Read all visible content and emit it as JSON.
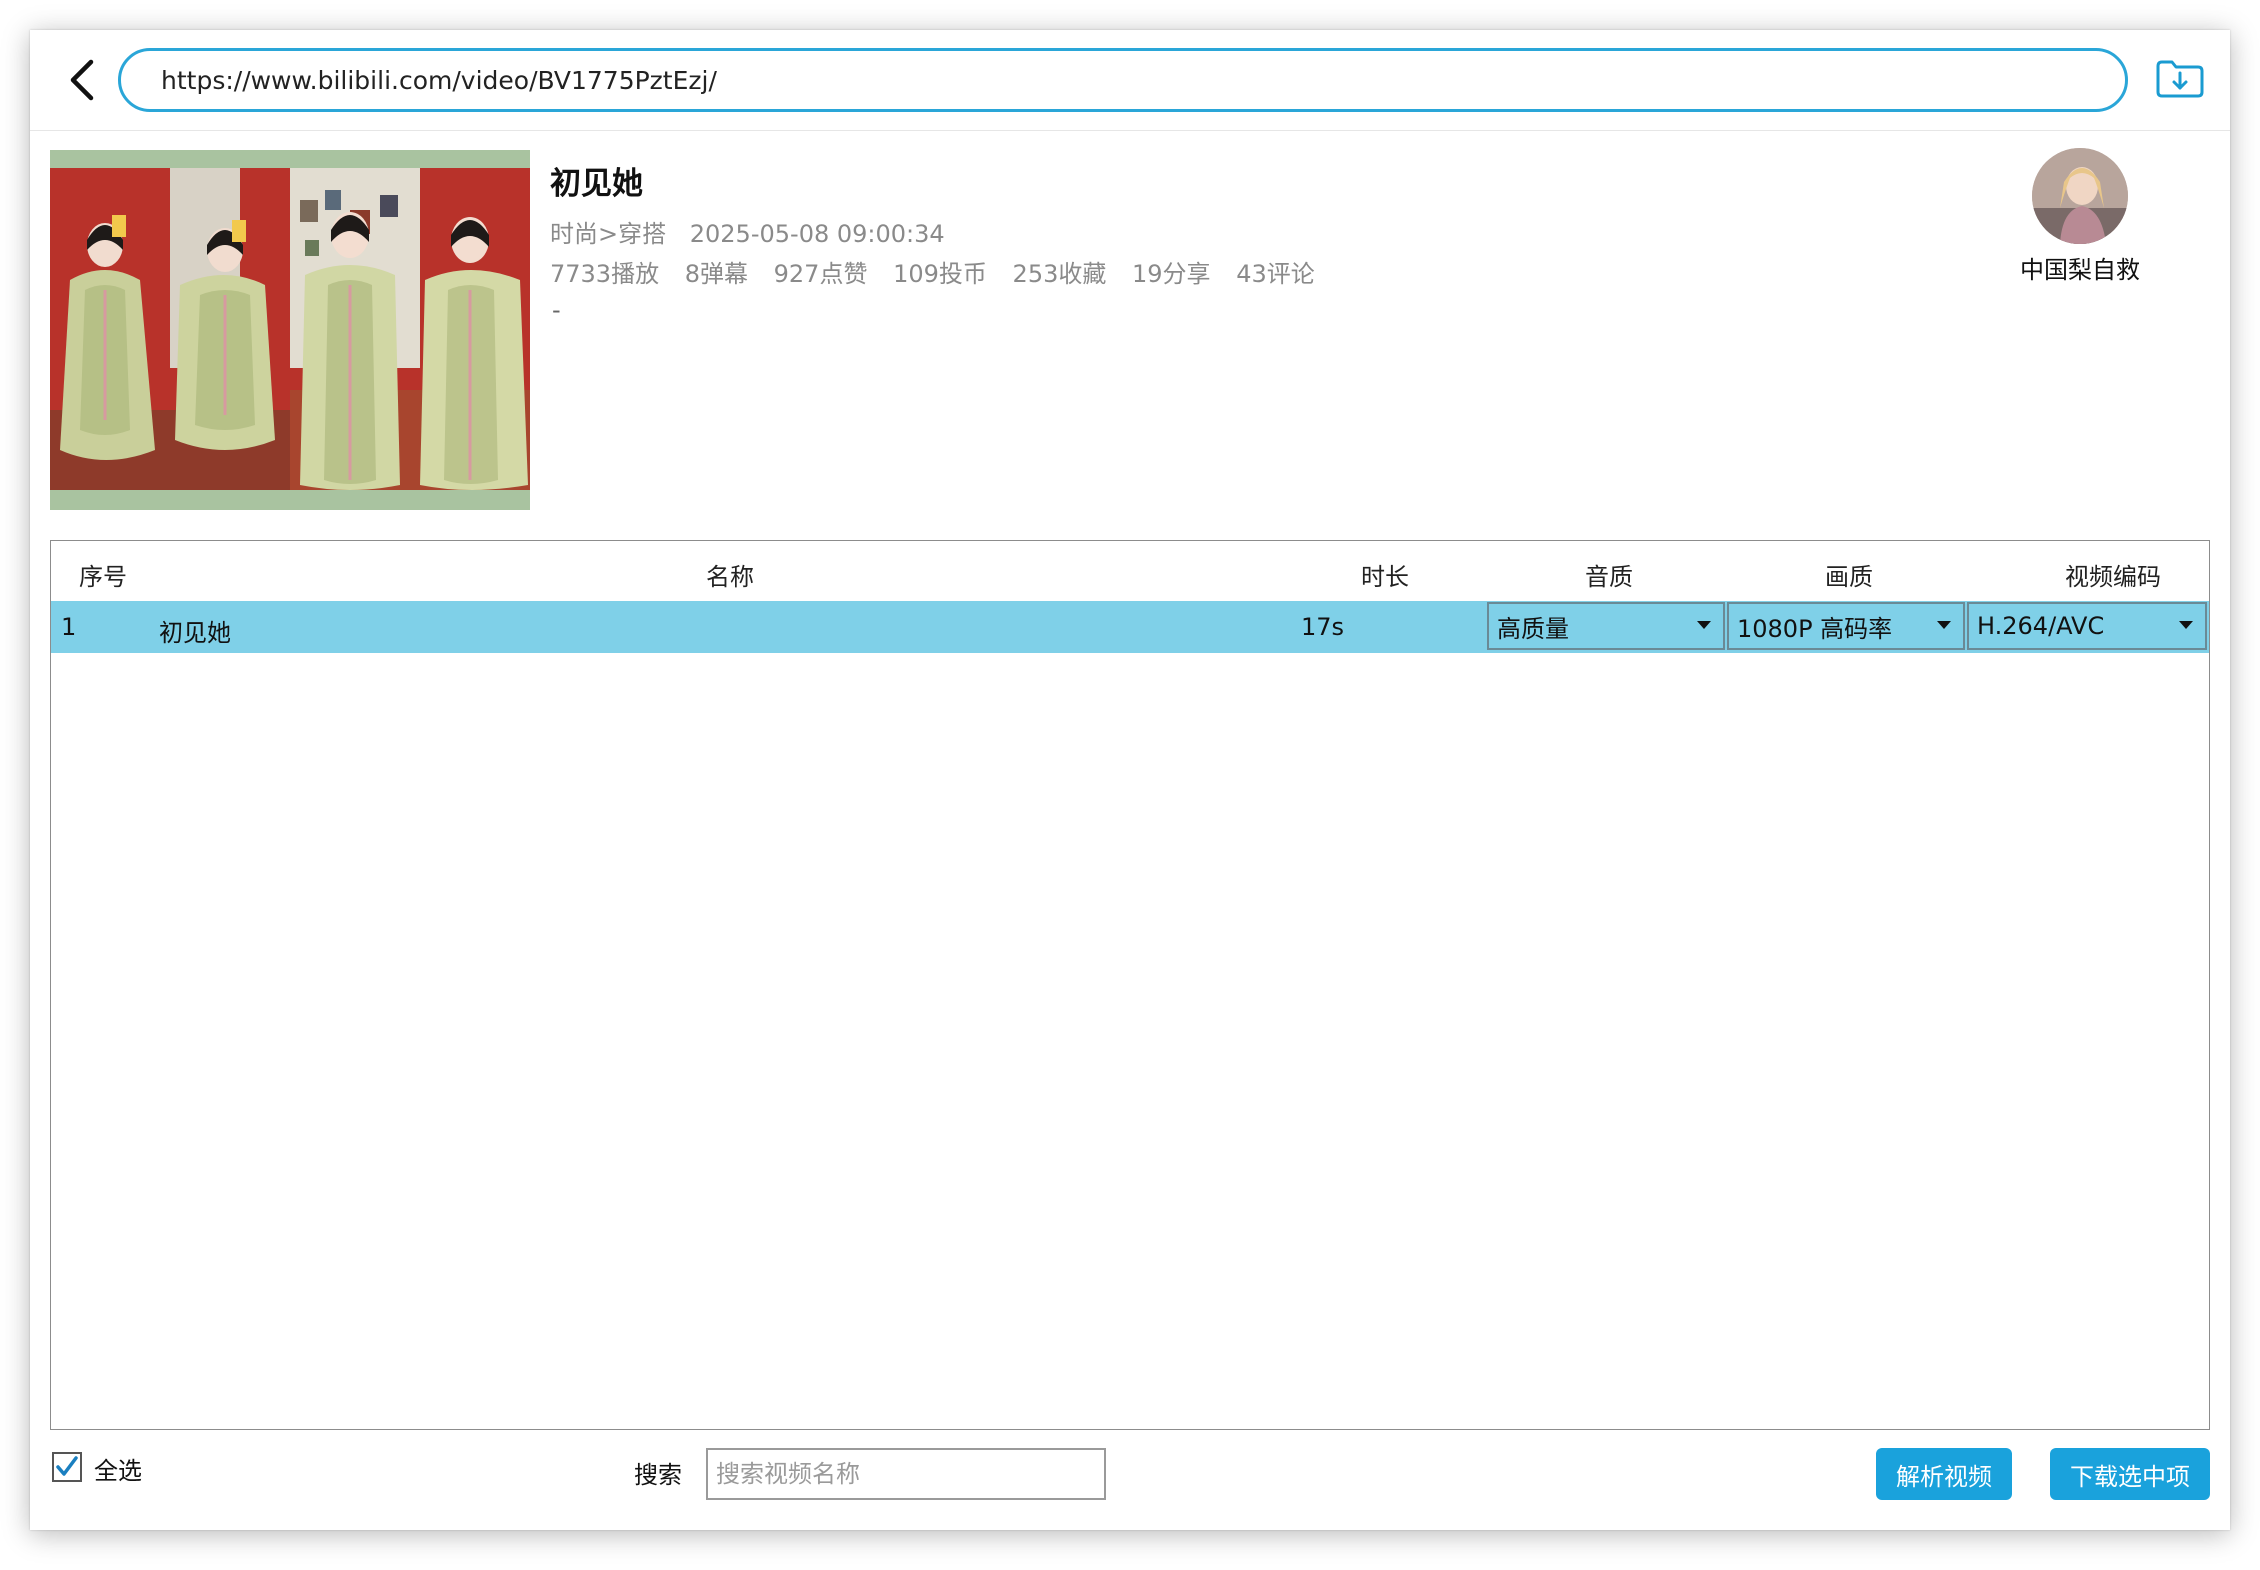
{
  "toolbar": {
    "url": "https://www.bilibili.com/video/BV1775PztEzj/"
  },
  "video": {
    "title": "初见她",
    "category": "时尚>穿搭",
    "date": "2025-05-08 09:00:34",
    "stats": [
      "7733播放",
      "8弹幕",
      "927点赞",
      "109投币",
      "253收藏",
      "19分享",
      "43评论"
    ],
    "description": "-"
  },
  "uploader": {
    "name": "中国梨自救"
  },
  "table": {
    "headers": {
      "index": "序号",
      "name": "名称",
      "duration": "时长",
      "audio": "音质",
      "video_quality": "画质",
      "codec": "视频编码"
    },
    "rows": [
      {
        "index": "1",
        "name": "初见她",
        "duration": "17s",
        "audio": "高质量",
        "video_quality": "1080P 高码率",
        "codec": "H.264/AVC",
        "selected": true
      }
    ]
  },
  "footer": {
    "select_all_label": "全选",
    "select_all_checked": true,
    "search_label": "搜索",
    "search_placeholder": "搜索视频名称",
    "parse_button": "解析视频",
    "download_button": "下载选中项"
  },
  "colors": {
    "accent": "#1aa2dc",
    "url_border": "#2aa6d8",
    "selected_row": "#7fd0e8"
  },
  "icons": {
    "back": "chevron-left-icon",
    "download": "folder-download-icon",
    "checkbox": "checkmark-icon",
    "dropdown": "caret-down-icon"
  }
}
